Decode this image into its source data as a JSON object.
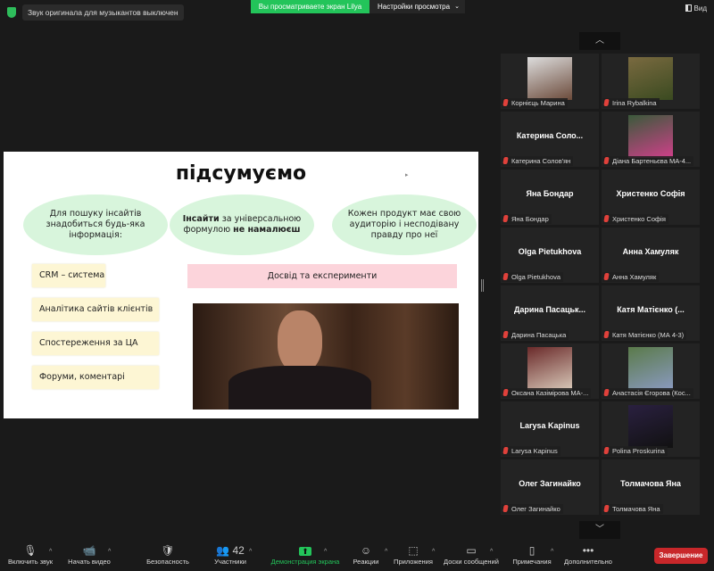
{
  "top": {
    "audio_note": "Звук оригинала для музыкантов выключен",
    "viewing": "Вы просматриваете экран Lilya",
    "view_settings": "Настройки просмотра",
    "view_button": "Вид",
    "chevron": "⌄"
  },
  "slide": {
    "title": "підсумуємо",
    "ovals": [
      {
        "text": "Для пошуку інсайтів знадобиться будь-яка інформація:"
      },
      {
        "bold1": "Інсайти",
        "mid": " за універсальною формулою ",
        "bold2": "не намалюєш"
      },
      {
        "text": "Кожен продукт має свою аудиторію і несподівану правду про неї"
      }
    ],
    "boxes": [
      "CRM – система",
      "Аналітика сайтів клієнтів",
      "Спостереження за ЦА",
      "Форуми, коментарі"
    ],
    "pink": "Досвід та експерименти"
  },
  "gallery": {
    "up": "︿",
    "down": "﹀",
    "participants": [
      {
        "name": "Корнієць Марина",
        "photo": true,
        "c": [
          "#ddd",
          "#6b4a3a"
        ]
      },
      {
        "name": "Irina Rybalkina",
        "photo": true,
        "c": [
          "#7a6a40",
          "#3a4a20"
        ]
      },
      {
        "big": "Катерина  Соло...",
        "name": "Катерина Солов'ян"
      },
      {
        "name": "Діана Бартеньєва МА-4...",
        "photo": true,
        "c": [
          "#3a5a3a",
          "#d0408a"
        ]
      },
      {
        "big": "Яна Бондар",
        "name": "Яна Бондар"
      },
      {
        "big": "Христенко Софія",
        "name": "Христенко Софія"
      },
      {
        "big": "Olga Pietukhova",
        "name": "Olga Pietukhova"
      },
      {
        "big": "Анна Хамуляк",
        "name": "Анна Хамуляк"
      },
      {
        "big": "Дарина  Пасацьк...",
        "name": "Дарина Пасацька"
      },
      {
        "big": "Катя  Матієнко  (...",
        "name": "Катя Матієнко (МА 4-3)"
      },
      {
        "name": "Оксана Казімірова МА-...",
        "photo": true,
        "c": [
          "#6a2a2a",
          "#d8c8b8"
        ]
      },
      {
        "name": "Анастасія Єгорова (Кос...",
        "photo": true,
        "c": [
          "#5a7a4a",
          "#8a9ac0"
        ]
      },
      {
        "big": "Larysa Kapinus",
        "name": "Larysa Kapinus"
      },
      {
        "name": "Polina Proskurina",
        "photo": true,
        "c": [
          "#2a2040",
          "#111"
        ]
      },
      {
        "big": "Олег Загинайко",
        "name": "Олег Загинайко"
      },
      {
        "big": "Толмачова Яна",
        "name": "Толмачова Яна"
      }
    ]
  },
  "toolbar": {
    "items": [
      {
        "label": "Включить звук",
        "icon": "🎙",
        "caret": true,
        "name": "unmute"
      },
      {
        "label": "Начать видео",
        "icon": "📹",
        "caret": true,
        "name": "start-video"
      },
      {
        "label": "Безопасность",
        "icon": "🛡",
        "caret": false,
        "name": "security"
      },
      {
        "label": "Участники",
        "icon": "👥 42",
        "caret": true,
        "name": "participants"
      },
      {
        "label": "Демонстрация экрана",
        "icon": "⬆",
        "caret": true,
        "name": "share-screen"
      },
      {
        "label": "Реакции",
        "icon": "☺",
        "caret": true,
        "name": "reactions"
      },
      {
        "label": "Приложения",
        "icon": "⬚",
        "caret": true,
        "name": "apps"
      },
      {
        "label": "Доски сообщений",
        "icon": "▭",
        "caret": true,
        "name": "whiteboards"
      },
      {
        "label": "Примечания",
        "icon": "▯",
        "caret": true,
        "name": "notes"
      },
      {
        "label": "Дополнительно",
        "icon": "•••",
        "caret": false,
        "name": "more"
      }
    ],
    "end": "Завершение",
    "share_color": "#23c45a"
  }
}
